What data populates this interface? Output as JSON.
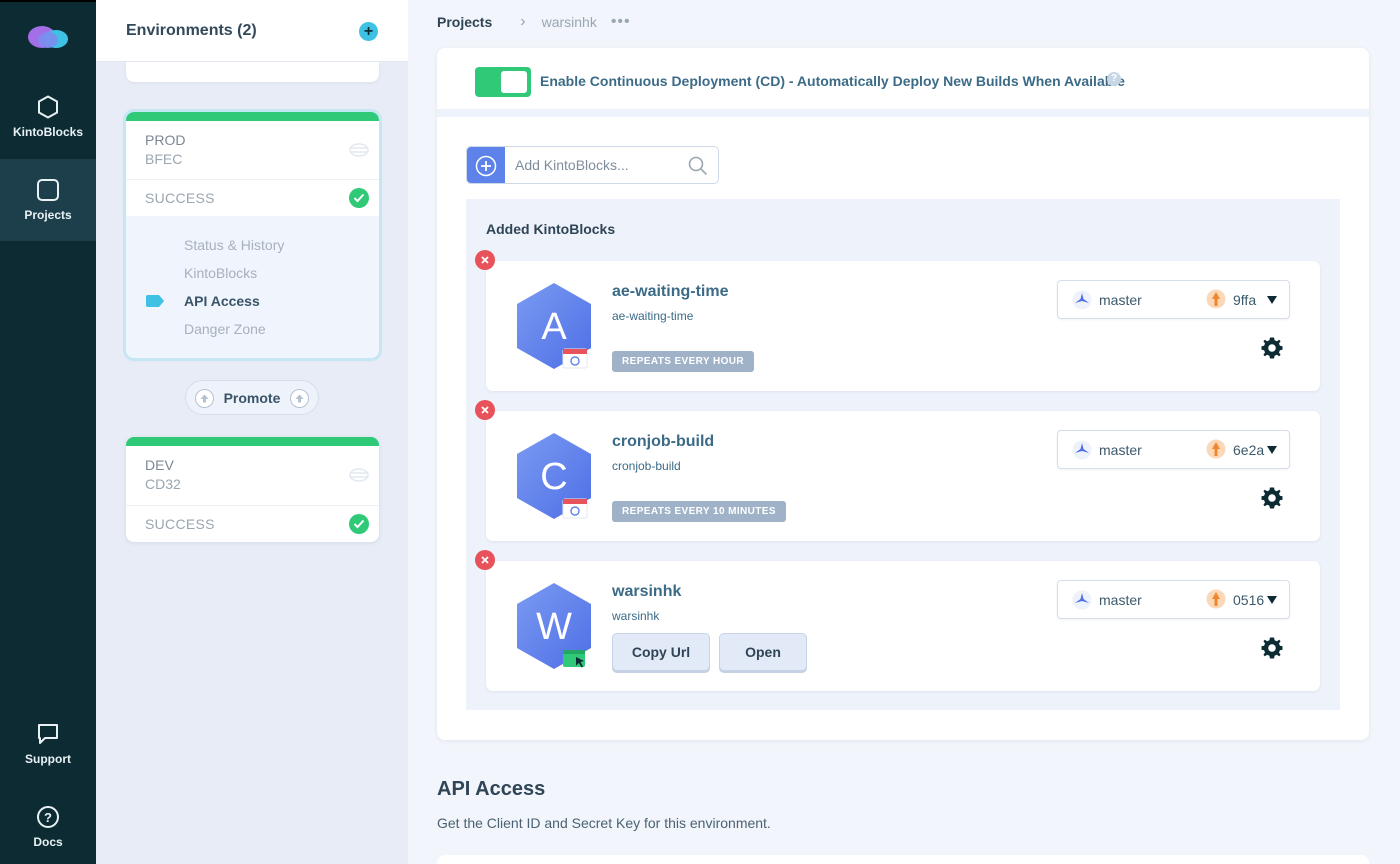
{
  "colors": {
    "rail_bg": "#0d2b33",
    "accent_green": "#2fc977",
    "accent_blue": "#5d83ea",
    "remove_red": "#e8525a",
    "tag_gray": "#9fb2c8"
  },
  "nav": {
    "items": [
      {
        "label": "KintoBlocks",
        "icon": "hexagon-icon"
      },
      {
        "label": "Projects",
        "icon": "square-icon"
      },
      {
        "label": "Support",
        "icon": "chat-icon"
      },
      {
        "label": "Docs",
        "icon": "help-circle-icon"
      }
    ]
  },
  "environments": {
    "title": "Environments (2)",
    "cards": [
      {
        "name": "PROD",
        "code": "BFEC",
        "status": "SUCCESS",
        "submenu": [
          "Status & History",
          "KintoBlocks",
          "API Access",
          "Danger Zone"
        ],
        "active_submenu": "API Access"
      },
      {
        "name": "DEV",
        "code": "CD32",
        "status": "SUCCESS"
      }
    ],
    "promote_label": "Promote"
  },
  "breadcrumb": {
    "root": "Projects",
    "current": "warsinhk",
    "more": "•••"
  },
  "cd": {
    "enabled": true,
    "label": "Enable Continuous Deployment (CD) - Automatically Deploy New Builds When Available",
    "help": "?"
  },
  "search": {
    "placeholder": "Add KintoBlocks..."
  },
  "kintoblocks": {
    "heading": "Added KintoBlocks",
    "items": [
      {
        "letter": "A",
        "title": "ae-waiting-time",
        "subtitle": "ae-waiting-time",
        "tag": "REPEATS EVERY HOUR",
        "badge_icon": "calendar-refresh-icon",
        "branch": "master",
        "commit": "9ffa"
      },
      {
        "letter": "C",
        "title": "cronjob-build",
        "subtitle": "cronjob-build",
        "tag": "REPEATS EVERY 10 MINUTES",
        "badge_icon": "calendar-refresh-icon",
        "branch": "master",
        "commit": "6e2a"
      },
      {
        "letter": "W",
        "title": "warsinhk",
        "subtitle": "warsinhk",
        "badge_icon": "website-cursor-icon",
        "branch": "master",
        "commit": "0516",
        "buttons": [
          "Copy Url",
          "Open"
        ]
      }
    ]
  },
  "api": {
    "title": "API Access",
    "description": "Get the Client ID and Secret Key for this environment."
  }
}
